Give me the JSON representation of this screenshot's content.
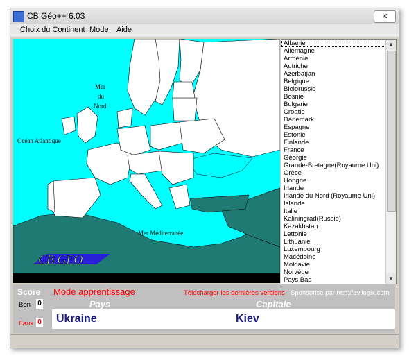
{
  "window": {
    "title": "CB Géo++ 6.03",
    "close_glyph": "✕"
  },
  "menu": {
    "items": [
      "Choix du Continent",
      "Mode",
      "Aide"
    ]
  },
  "map": {
    "labels": {
      "north_sea": [
        "Mer",
        "du",
        "Nord"
      ],
      "atlantic": "Océan Atlantique",
      "mediterranean": "Mer Méditerranée"
    },
    "logo_text": "CB GEO",
    "colors": {
      "sea": "#00ffff",
      "land": "#ffffff",
      "outside": "#1f7a73",
      "border": "#000000"
    }
  },
  "country_list": {
    "selected": "Albanie",
    "items": [
      "Albanie",
      "Allemagne",
      "Arménie",
      "Autriche",
      "Azerbaïjan",
      "Belgique",
      "Bielorussie",
      "Bosnie",
      "Bulgarie",
      "Croatie",
      "Danemark",
      "Espagne",
      "Estonie",
      "Finlande",
      "France",
      "Géorgie",
      "Grande-Bretagne(Royaume Uni)",
      "Grèce",
      "Hongrie",
      "Irlande",
      "Irlande du Nord (Royaume Uni)",
      "Islande",
      "Italie",
      "Kaliningrad(Russie)",
      "Kazakhstan",
      "Lettonie",
      "Lithuanie",
      "Luxembourg",
      "Macédoine",
      "Moldavie",
      "Norvège",
      "Pays Bas"
    ]
  },
  "panel": {
    "score_label": "Score",
    "mode": "Mode apprentissage",
    "download": "Télécharger les dernières versions",
    "sponsor": "Sponsorisé par http://avilogix.com",
    "bon_label": "Bon",
    "bon_value": "0",
    "faux_label": "Faux",
    "faux_value": "0",
    "pays_header": "Pays",
    "capitale_header": "Capitale",
    "pays_value": "Ukraine",
    "capitale_value": "Kiev"
  }
}
